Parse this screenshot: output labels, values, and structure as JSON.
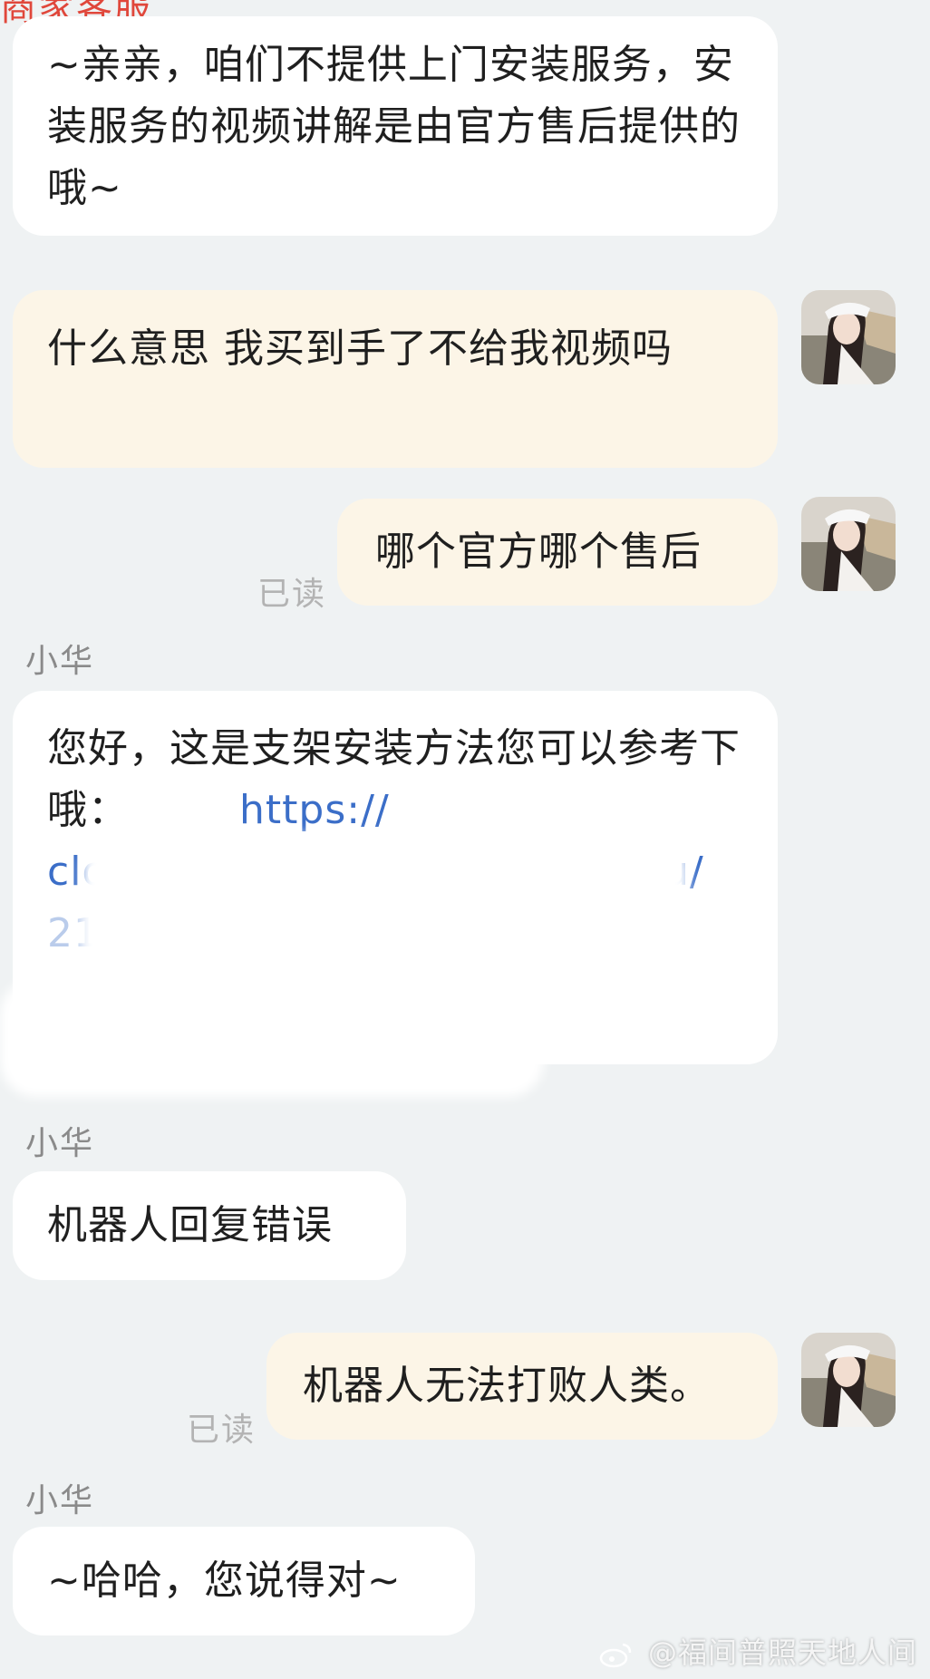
{
  "header_clip": "商家客服",
  "messages": [
    {
      "id": "m1",
      "text": "~亲亲，咱们不提供上门安装服务，安装服务的视频讲解是由官方售后提供的哦~"
    },
    {
      "id": "m2",
      "text": "什么意思 我买到手了不给我视频吗"
    },
    {
      "id": "m3",
      "text": "哪个官方哪个售后",
      "status": "已读"
    },
    {
      "id": "m4",
      "sender": "小华",
      "text": "您好，这是支架安装方法您可以参考下哦：",
      "link_visible": "https://",
      "link_line2_start": "clo",
      "link_line2_end": "u/",
      "link_line3_start": "21"
    },
    {
      "id": "m5",
      "sender": "小华",
      "text": "机器人回复错误"
    },
    {
      "id": "m6",
      "text": "机器人无法打败人类。",
      "status": "已读"
    },
    {
      "id": "m7",
      "sender": "小华",
      "text": "~哈哈，您说得对~"
    }
  ],
  "watermark": "@福间普照天地人间",
  "icons": {
    "avatar": "user-avatar-photo",
    "watermark_logo": "weibo-icon"
  },
  "colors": {
    "background": "#eff2f3",
    "incoming_bubble": "#ffffff",
    "outgoing_bubble": "#fcf5e7",
    "link": "#3b6ec8",
    "read_status": "#b3b3b3"
  }
}
